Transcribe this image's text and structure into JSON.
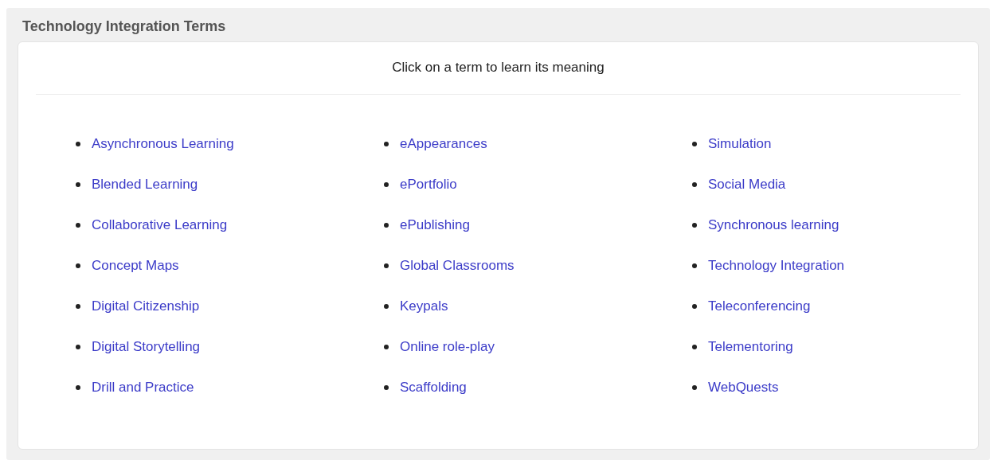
{
  "panel": {
    "title": "Technology Integration Terms"
  },
  "card": {
    "instruction": "Click on a term to learn its meaning",
    "columns": [
      [
        "Asynchronous Learning",
        "Blended Learning",
        "Collaborative Learning",
        "Concept Maps",
        "Digital Citizenship",
        "Digital Storytelling",
        "Drill and Practice"
      ],
      [
        "eAppearances",
        "ePortfolio",
        "ePublishing",
        "Global Classrooms",
        "Keypals",
        "Online role-play",
        "Scaffolding"
      ],
      [
        "Simulation",
        "Social Media",
        "Synchronous learning",
        "Technology Integration",
        "Teleconferencing",
        "Telementoring",
        "WebQuests"
      ]
    ]
  }
}
